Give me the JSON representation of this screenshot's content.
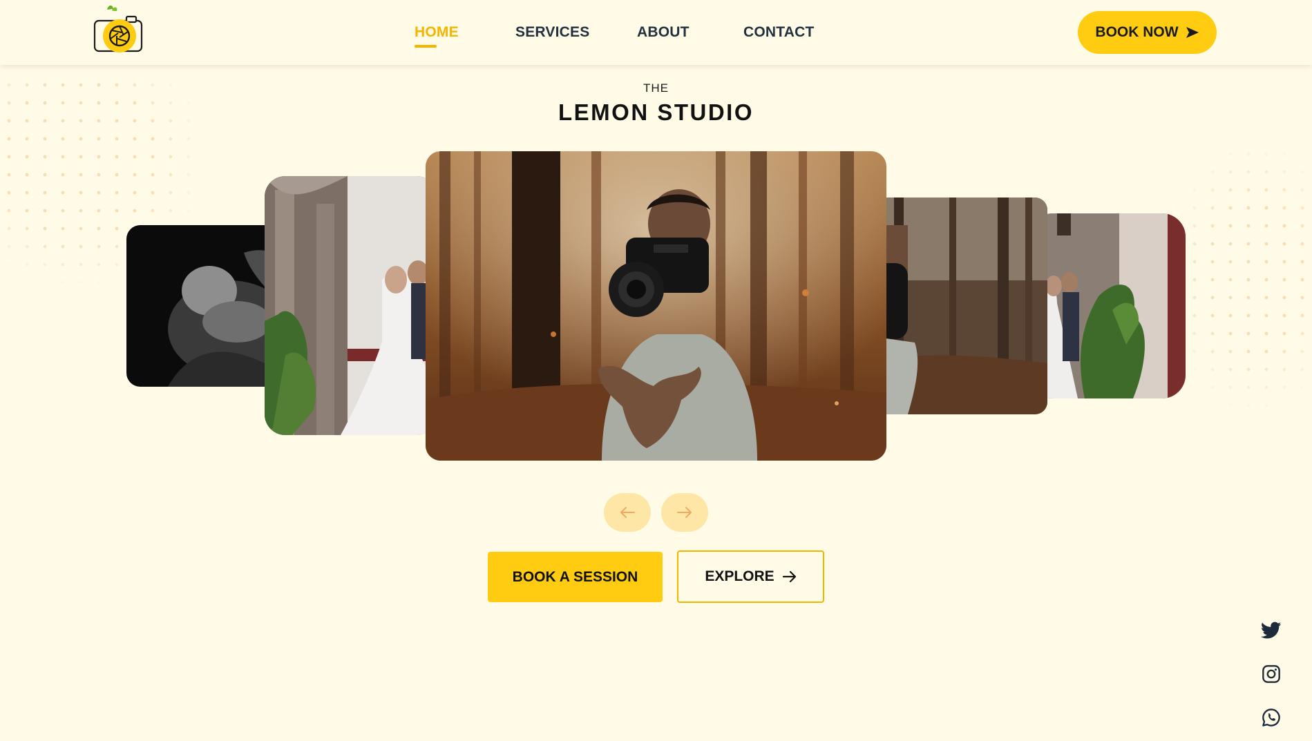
{
  "brand": {
    "logo_alt": "camera-lemon-logo"
  },
  "nav": {
    "items": [
      {
        "label": "HOME",
        "active": true
      },
      {
        "label": "SERVICES",
        "active": false
      },
      {
        "label": "ABOUT",
        "active": false
      },
      {
        "label": "CONTACT",
        "active": false
      }
    ],
    "cta": "BOOK NOW"
  },
  "hero": {
    "pre_title": "THE",
    "title": "LEMON STUDIO"
  },
  "gallery": {
    "slides": [
      {
        "subject": "newborn-black-white"
      },
      {
        "subject": "wedding-couple-arches"
      },
      {
        "subject": "man-tossing-camera-forest"
      },
      {
        "subject": "man-camera-forest-side"
      },
      {
        "subject": "wedding-couple-plants"
      }
    ],
    "prev_icon": "arrow-left-icon",
    "next_icon": "arrow-right-icon"
  },
  "actions": {
    "primary": "BOOK A SESSION",
    "secondary": "EXPLORE"
  },
  "social": [
    "twitter-icon",
    "instagram-icon",
    "whatsapp-icon"
  ],
  "colors": {
    "accent": "#ffcc11",
    "background": "#fffbe6",
    "text": "#1c2433"
  }
}
